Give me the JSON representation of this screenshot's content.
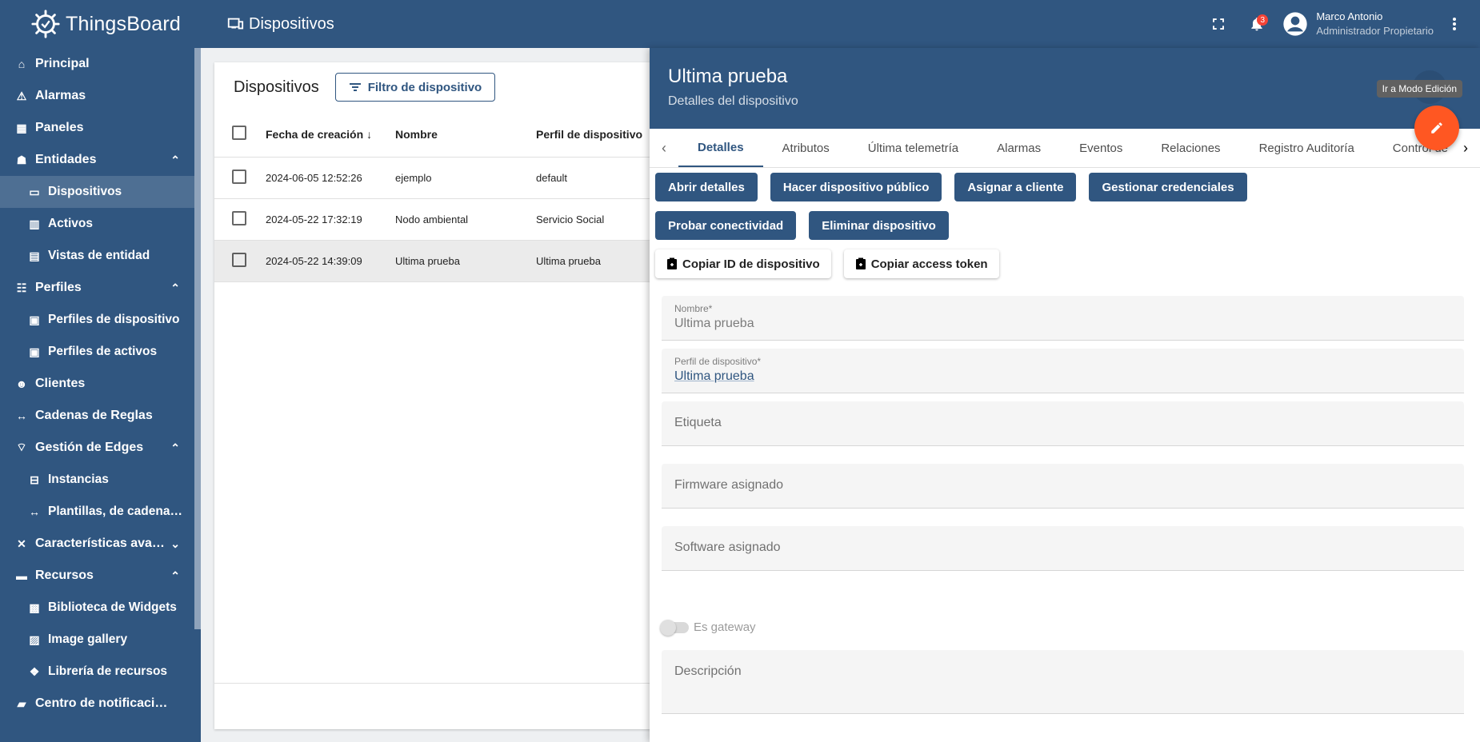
{
  "brand": {
    "name": "ThingsBoard"
  },
  "sidebar": {
    "items": [
      {
        "label": "Principal",
        "icon": "home-icon",
        "sub": false
      },
      {
        "label": "Alarmas",
        "icon": "warning-icon",
        "sub": false
      },
      {
        "label": "Paneles",
        "icon": "dashboard-icon",
        "sub": false
      },
      {
        "label": "Entidades",
        "icon": "entities-icon",
        "sub": false,
        "expanded": true
      },
      {
        "label": "Dispositivos",
        "icon": "devices-icon",
        "sub": true,
        "active": true
      },
      {
        "label": "Activos",
        "icon": "assets-icon",
        "sub": true
      },
      {
        "label": "Vistas de entidad",
        "icon": "entity-view-icon",
        "sub": true
      },
      {
        "label": "Perfiles",
        "icon": "profiles-icon",
        "sub": false,
        "expanded": true
      },
      {
        "label": "Perfiles de dispositivo",
        "icon": "device-profile-icon",
        "sub": true
      },
      {
        "label": "Perfiles de activos",
        "icon": "asset-profile-icon",
        "sub": true
      },
      {
        "label": "Clientes",
        "icon": "customers-icon",
        "sub": false
      },
      {
        "label": "Cadenas de Reglas",
        "icon": "rule-chain-icon",
        "sub": false
      },
      {
        "label": "Gestión de Edges",
        "icon": "edge-icon",
        "sub": false,
        "expanded": true
      },
      {
        "label": "Instancias",
        "icon": "router-icon",
        "sub": true
      },
      {
        "label": "Plantillas, de cadena de...",
        "icon": "rule-chain-template-icon",
        "sub": true
      },
      {
        "label": "Características avanzad...",
        "icon": "tools-icon",
        "sub": false,
        "collapsed": true
      },
      {
        "label": "Recursos",
        "icon": "folder-icon",
        "sub": false,
        "expanded": true
      },
      {
        "label": "Biblioteca de Widgets",
        "icon": "widgets-icon",
        "sub": true
      },
      {
        "label": "Image gallery",
        "icon": "image-gallery-icon",
        "sub": true
      },
      {
        "label": "Librería de recursos",
        "icon": "resource-library-icon",
        "sub": true
      },
      {
        "label": "Centro de notificaciones",
        "icon": "notification-center-icon",
        "sub": false
      }
    ]
  },
  "topbar": {
    "title": "Dispositivos",
    "notifications_count": "3",
    "user_name": "Marco Antonio",
    "user_role": "Administrador Propietario"
  },
  "list": {
    "title": "Dispositivos",
    "filter_label": "Filtro de dispositivo",
    "columns": [
      "Fecha de creación",
      "Nombre",
      "Perfil de dispositivo"
    ],
    "rows": [
      {
        "date": "2024-06-05 12:52:26",
        "name": "ejemplo",
        "profile": "default"
      },
      {
        "date": "2024-05-22 17:32:19",
        "name": "Nodo ambiental",
        "profile": "Servicio Social"
      },
      {
        "date": "2024-05-22 14:39:09",
        "name": "Ultima prueba",
        "profile": "Ultima prueba"
      }
    ]
  },
  "details": {
    "title": "Ultima prueba",
    "subtitle": "Detalles del dispositivo",
    "tooltip": "Ir a Modo Edición",
    "tabs": [
      "Detalles",
      "Atributos",
      "Última telemetría",
      "Alarmas",
      "Eventos",
      "Relaciones",
      "Registro Auditoría",
      "Control de"
    ],
    "actions": [
      "Abrir detalles",
      "Hacer dispositivo público",
      "Asignar a cliente",
      "Gestionar credenciales",
      "Probar conectividad",
      "Eliminar dispositivo"
    ],
    "copy_id": "Copiar ID de dispositivo",
    "copy_token": "Copiar access token",
    "name_label": "Nombre*",
    "name_value": "Ultima prueba",
    "profile_label": "Perfil de dispositivo*",
    "profile_value": "Ultima prueba",
    "label_placeholder": "Etiqueta",
    "firmware_placeholder": "Firmware asignado",
    "software_placeholder": "Software asignado",
    "gateway_label": "Es gateway",
    "description_placeholder": "Descripción"
  },
  "colors": {
    "primary": "#305680",
    "accent": "#ff5722",
    "badge": "#f44336"
  }
}
